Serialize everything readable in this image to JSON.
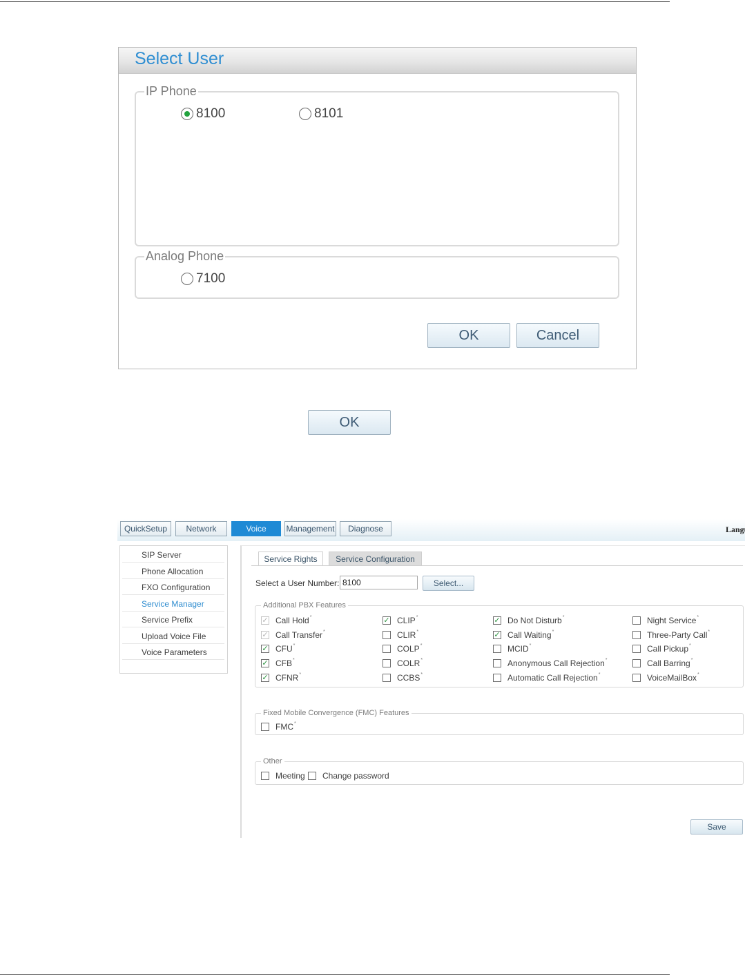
{
  "dialog": {
    "title": "Select User",
    "ip_phone": {
      "legend": "IP Phone",
      "options": [
        {
          "label": "8100",
          "selected": true
        },
        {
          "label": "8101",
          "selected": false
        }
      ]
    },
    "analog_phone": {
      "legend": "Analog Phone",
      "options": [
        {
          "label": "7100",
          "selected": false
        }
      ]
    },
    "ok_label": "OK",
    "cancel_label": "Cancel"
  },
  "standalone_ok_label": "OK",
  "admin": {
    "nav": {
      "tabs": [
        {
          "label": "QuickSetup",
          "active": false
        },
        {
          "label": "Network",
          "active": false
        },
        {
          "label": "Voice",
          "active": true
        },
        {
          "label": "Management",
          "active": false
        },
        {
          "label": "Diagnose",
          "active": false
        }
      ],
      "language_label": "Langu"
    },
    "sidebar": {
      "items": [
        {
          "label": "SIP Server",
          "active": false
        },
        {
          "label": "Phone Allocation",
          "active": false
        },
        {
          "label": "FXO Configuration",
          "active": false
        },
        {
          "label": "Service Manager",
          "active": true
        },
        {
          "label": "Service Prefix",
          "active": false
        },
        {
          "label": "Upload Voice File",
          "active": false
        },
        {
          "label": "Voice Parameters",
          "active": false
        }
      ]
    },
    "subtabs": [
      {
        "label": "Service Rights",
        "active": true
      },
      {
        "label": "Service Configuration",
        "active": false
      }
    ],
    "user_select": {
      "label": "Select a User Number:",
      "value": "8100",
      "button_label": "Select..."
    },
    "pbx": {
      "legend": "Additional PBX Features",
      "columns": [
        [
          {
            "label": "Call Hold",
            "checked": true,
            "disabled": true
          },
          {
            "label": "Call Transfer",
            "checked": true,
            "disabled": true
          },
          {
            "label": "CFU",
            "checked": true,
            "disabled": false
          },
          {
            "label": "CFB",
            "checked": true,
            "disabled": false
          },
          {
            "label": "CFNR",
            "checked": true,
            "disabled": false
          }
        ],
        [
          {
            "label": "CLIP",
            "checked": true,
            "disabled": false
          },
          {
            "label": "CLIR",
            "checked": false,
            "disabled": false
          },
          {
            "label": "COLP",
            "checked": false,
            "disabled": false
          },
          {
            "label": "COLR",
            "checked": false,
            "disabled": false
          },
          {
            "label": "CCBS",
            "checked": false,
            "disabled": false
          }
        ],
        [
          {
            "label": "Do Not Disturb",
            "checked": true,
            "disabled": false
          },
          {
            "label": "Call Waiting",
            "checked": true,
            "disabled": false
          },
          {
            "label": "MCID",
            "checked": false,
            "disabled": false
          },
          {
            "label": "Anonymous Call Rejection",
            "checked": false,
            "disabled": false
          },
          {
            "label": "Automatic Call Rejection",
            "checked": false,
            "disabled": false
          }
        ],
        [
          {
            "label": "Night Service",
            "checked": false,
            "disabled": false
          },
          {
            "label": "Three-Party Call",
            "checked": false,
            "disabled": false
          },
          {
            "label": "Call Pickup",
            "checked": false,
            "disabled": false
          },
          {
            "label": "Call Barring",
            "checked": false,
            "disabled": false
          },
          {
            "label": "VoiceMailBox",
            "checked": false,
            "disabled": false
          }
        ]
      ]
    },
    "fmc": {
      "legend": "Fixed Mobile Convergence (FMC) Features",
      "items": [
        {
          "label": "FMC",
          "checked": false
        }
      ]
    },
    "other": {
      "legend": "Other",
      "items": [
        {
          "label": "Meeting",
          "checked": false
        },
        {
          "label": "Change password",
          "checked": false
        }
      ]
    },
    "save_label": "Save",
    "superscript": "*"
  }
}
